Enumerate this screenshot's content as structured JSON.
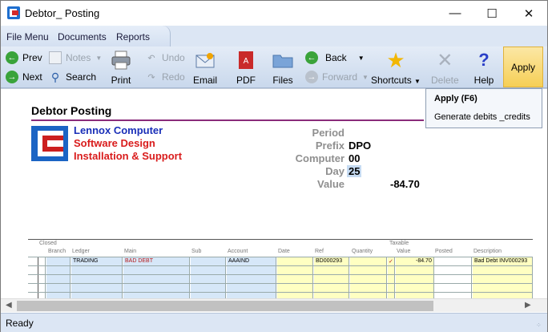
{
  "window": {
    "title": "Debtor_ Posting"
  },
  "menu": [
    "File Menu",
    "Documents",
    "Reports"
  ],
  "toolbar": {
    "prev": "Prev",
    "next": "Next",
    "notes": "Notes",
    "search": "Search",
    "print": "Print",
    "undo": "Undo",
    "redo": "Redo",
    "email": "Email",
    "pdf": "PDF",
    "files": "Files",
    "back": "Back",
    "forward": "Forward",
    "shortcuts": "Shortcuts",
    "delete": "Delete",
    "help": "Help",
    "apply": "Apply"
  },
  "tooltip": {
    "title": "Apply (F6)",
    "description": "Generate debits _credits"
  },
  "form": {
    "title": "Debtor Posting",
    "company_lines": [
      "Lennox Computer",
      "Software Design",
      "Installation & Support"
    ],
    "fields": [
      {
        "label": "Period",
        "value": ""
      },
      {
        "label": "Prefix",
        "value": "DPO"
      },
      {
        "label": "Computer",
        "value": "00"
      },
      {
        "label": "Day",
        "value": "25"
      },
      {
        "label": "Value",
        "value": "-84.70"
      }
    ]
  },
  "grid": {
    "headers_top": {
      "closed": "Closed",
      "taxable": "Taxable"
    },
    "headers": [
      "Branch",
      "Ledger",
      "Main",
      "Sub",
      "Account",
      "Date",
      "Ref",
      "Quantity",
      "Value",
      "Posted",
      "Description"
    ],
    "row": {
      "ledger": "TRADING",
      "main": "BAD DEBT",
      "account": "AAAIND",
      "ref": "BD000293",
      "taxable": "✓",
      "value": "-84.70",
      "description": "Bad Debt INV000293"
    }
  },
  "status": {
    "text": "Ready"
  }
}
